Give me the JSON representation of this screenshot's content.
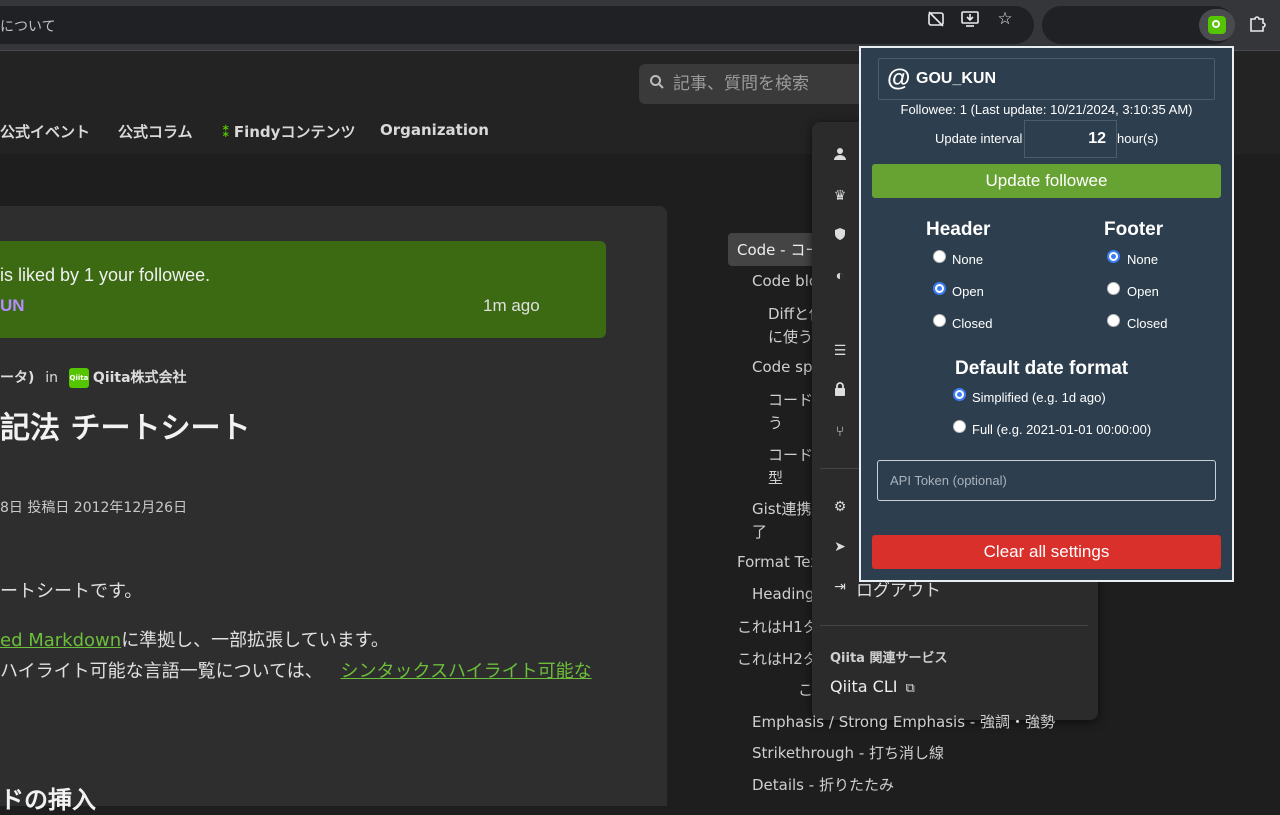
{
  "browser": {
    "url_text": "について",
    "icons": [
      "eye-off-icon",
      "install-app-icon",
      "star-icon",
      "extension-puzzle-icon"
    ]
  },
  "site": {
    "search_placeholder": "記事、質問を検索",
    "nav": [
      "公式イベント",
      "公式コラム",
      "Findyコンテンツ",
      "Organization"
    ]
  },
  "article": {
    "liked_text": "is liked by 1 your followee.",
    "liked_user": "UN",
    "liked_time": "1m ago",
    "author_suffix": "ータ)",
    "author_in": "in",
    "org": "Qiita株式会社",
    "qiita_badge": "Qiita",
    "title": "記法 チートシート",
    "dates": "8日  投稿日 2012年12月26日",
    "line1": "ートシートです。",
    "line2_link": "ed Markdown",
    "line2_rest": "に準拠し、一部拡張しています。",
    "line3_text": "ハイライト可能な言語一覧については、",
    "line3_link": "シンタックスハイライト可能な",
    "section_heading": "ドの挿入"
  },
  "toc": [
    "Code - コー",
    "Code blo",
    "Diffと併",
    "に使う",
    "Code spa",
    "コード",
    "う",
    "コード",
    "型",
    "Gist連携(",
    "了",
    "Format Text",
    "Headings",
    "これはH1タ",
    "これはH2タ",
    "こ",
    "Emphasis / Strong Emphasis - 強調・強勢",
    "Strikethrough - 打ち消し線",
    "Details - 折りたたみ"
  ],
  "user_menu": {
    "logout": "ログアウト",
    "section": "Qiita 関連サービス",
    "cli": "Qiita CLI"
  },
  "popup": {
    "username": "GOU_KUN",
    "followee_info": "Followee: 1 (Last update: 10/21/2024, 3:10:35 AM)",
    "interval_label": "Update interval",
    "interval_value": "12",
    "interval_unit": "hour(s)",
    "update_button": "Update followee",
    "header_title": "Header",
    "footer_title": "Footer",
    "header_options": [
      "None",
      "Open",
      "Closed"
    ],
    "header_selected": "Open",
    "footer_options": [
      "None",
      "Open",
      "Closed"
    ],
    "footer_selected": "None",
    "date_title": "Default date format",
    "date_options": [
      "Simplified (e.g. 1d ago)",
      "Full (e.g. 2021-01-01 00:00:00)"
    ],
    "date_selected": "Simplified (e.g. 1d ago)",
    "api_placeholder": "API Token (optional)",
    "clear_button": "Clear all settings",
    "colors": {
      "update": "#67a332",
      "clear": "#d9302c",
      "popup_bg": "#2d3e4e",
      "radio_checked": "#3d7ef5"
    }
  }
}
